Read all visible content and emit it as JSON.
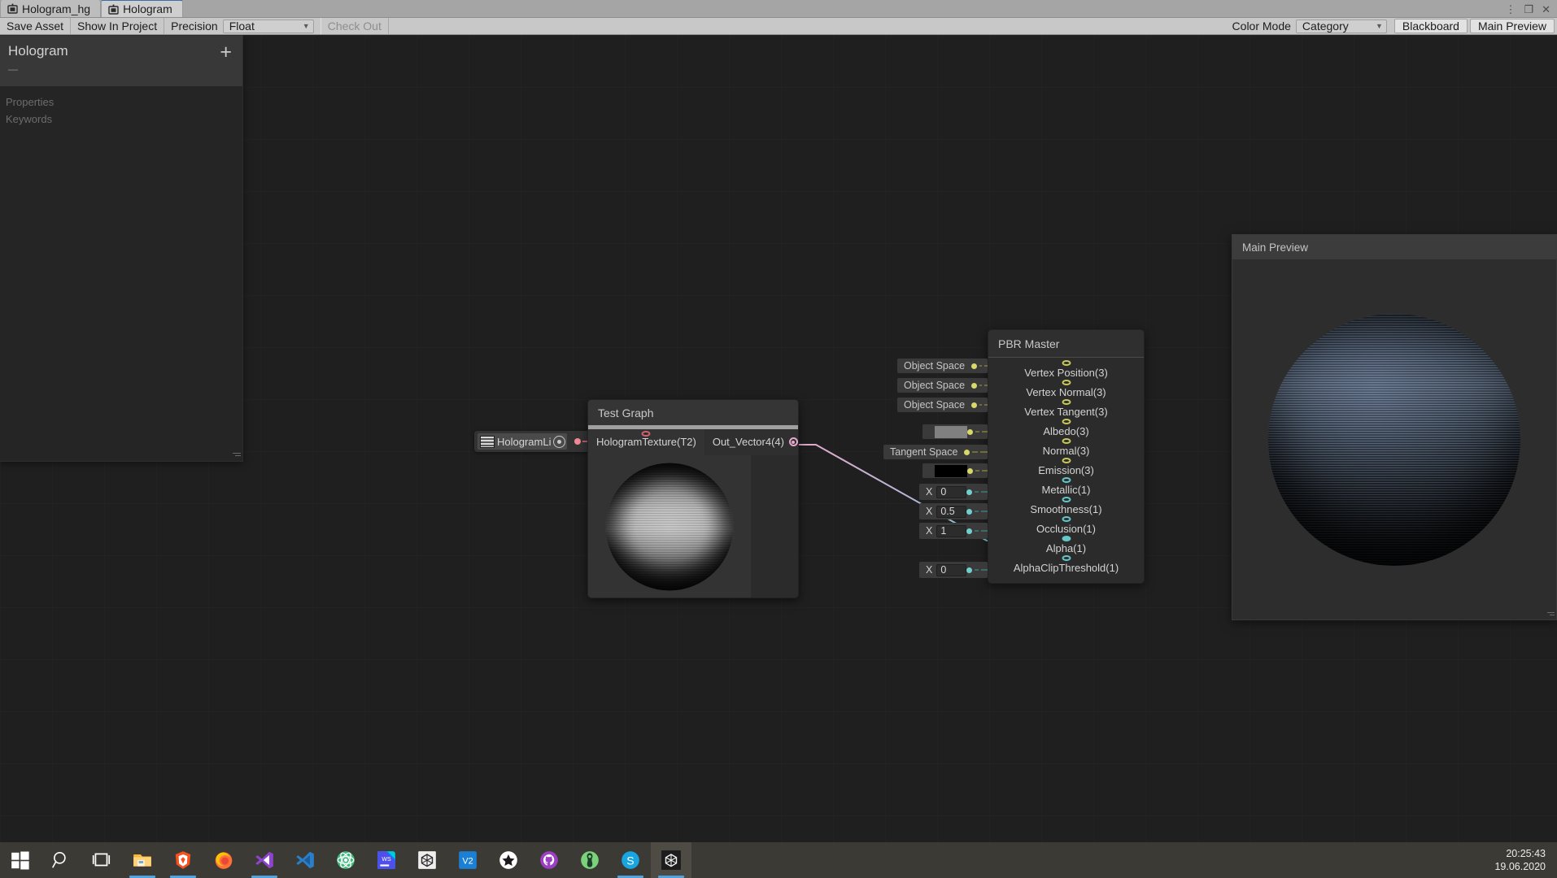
{
  "window": {
    "controls": [
      {
        "name": "more-options",
        "glyph": "⋮"
      },
      {
        "name": "restore",
        "glyph": "❐"
      },
      {
        "name": "close",
        "glyph": "✕"
      }
    ]
  },
  "tabs": [
    {
      "label": "Hologram_hg",
      "icon": "shader-graph-icon",
      "active": false
    },
    {
      "label": "Hologram",
      "icon": "shader-graph-icon",
      "active": true
    }
  ],
  "toolbar": {
    "save_asset": "Save Asset",
    "show_in_project": "Show In Project",
    "precision_label": "Precision",
    "precision_value": "Float",
    "check_out": "Check Out",
    "color_mode_label": "Color Mode",
    "color_mode_value": "Category",
    "blackboard": "Blackboard",
    "main_preview": "Main Preview"
  },
  "blackboard": {
    "title": "Hologram",
    "subtitle": "—",
    "add_glyph": "+",
    "sections": [
      "Properties",
      "Keywords"
    ]
  },
  "property_node": {
    "name": "HologramLi",
    "swatch": "texture-2d-swatch"
  },
  "test_graph_node": {
    "title": "Test Graph",
    "input_port": "HologramTexture(T2)",
    "output_port": "Out_Vector4(4)"
  },
  "pbr_master_node": {
    "title": "PBR Master",
    "slots": [
      {
        "label": "Vertex Position(3)",
        "type": "vec3",
        "input_kind": "dropdown",
        "input_value": "Object Space"
      },
      {
        "label": "Vertex Normal(3)",
        "type": "vec3",
        "input_kind": "dropdown",
        "input_value": "Object Space"
      },
      {
        "label": "Vertex Tangent(3)",
        "type": "vec3",
        "input_kind": "dropdown",
        "input_value": "Object Space"
      },
      {
        "label": "Albedo(3)",
        "type": "vec3",
        "input_kind": "color",
        "input_value": "#808080"
      },
      {
        "label": "Normal(3)",
        "type": "vec3",
        "input_kind": "dropdown",
        "input_value": "Tangent Space"
      },
      {
        "label": "Emission(3)",
        "type": "vec3",
        "input_kind": "color",
        "input_value": "#000000"
      },
      {
        "label": "Metallic(1)",
        "type": "float",
        "input_kind": "number",
        "input_axis": "X",
        "input_value": "0"
      },
      {
        "label": "Smoothness(1)",
        "type": "float",
        "input_kind": "number",
        "input_axis": "X",
        "input_value": "0.5"
      },
      {
        "label": "Occlusion(1)",
        "type": "float",
        "input_kind": "number",
        "input_axis": "X",
        "input_value": "1"
      },
      {
        "label": "Alpha(1)",
        "type": "float",
        "input_kind": "connected",
        "input_value": ""
      },
      {
        "label": "AlphaClipThreshold(1)",
        "type": "float",
        "input_kind": "number",
        "input_axis": "X",
        "input_value": "0"
      }
    ]
  },
  "main_preview": {
    "title": "Main Preview"
  },
  "taskbar": {
    "items": [
      {
        "name": "start-button",
        "icon": "windows-logo-icon",
        "active": false,
        "running": false
      },
      {
        "name": "search-button",
        "icon": "search-icon",
        "active": false,
        "running": false
      },
      {
        "name": "task-view-button",
        "icon": "task-view-icon",
        "active": false,
        "running": false
      },
      {
        "name": "file-explorer",
        "icon": "folder-icon",
        "active": false,
        "running": true
      },
      {
        "name": "brave-browser",
        "icon": "brave-lion-icon",
        "active": false,
        "running": true
      },
      {
        "name": "firefox-browser",
        "icon": "firefox-icon",
        "active": false,
        "running": false
      },
      {
        "name": "visual-studio",
        "icon": "visual-studio-icon",
        "active": false,
        "running": true
      },
      {
        "name": "vs-code",
        "icon": "vs-code-icon",
        "active": false,
        "running": false
      },
      {
        "name": "atom-editor",
        "icon": "atom-icon",
        "active": false,
        "running": false
      },
      {
        "name": "webstorm",
        "icon": "webstorm-icon",
        "active": false,
        "running": false
      },
      {
        "name": "unity-hub",
        "icon": "unity-hub-icon",
        "active": false,
        "running": false
      },
      {
        "name": "vmware",
        "icon": "vmware-icon",
        "active": false,
        "running": false
      },
      {
        "name": "star-app",
        "icon": "star-icon",
        "active": false,
        "running": false
      },
      {
        "name": "github-desktop",
        "icon": "github-icon",
        "active": false,
        "running": false
      },
      {
        "name": "android-studio",
        "icon": "android-studio-icon",
        "active": false,
        "running": false
      },
      {
        "name": "skype",
        "icon": "skype-icon",
        "active": false,
        "running": true
      },
      {
        "name": "unity-editor",
        "icon": "unity-icon",
        "active": true,
        "running": true
      }
    ],
    "clock_time": "20:25:43",
    "clock_date": "19.06.2020"
  },
  "colors": {
    "canvas_bg": "#1f1f1f",
    "node_bg": "#2b2b2b",
    "vec_port": "#c8c85c",
    "float_port": "#64c8c8",
    "texture_port": "#d4616f",
    "vector4_port": "#e7a8d0",
    "accent_blue": "#51a3e0"
  }
}
